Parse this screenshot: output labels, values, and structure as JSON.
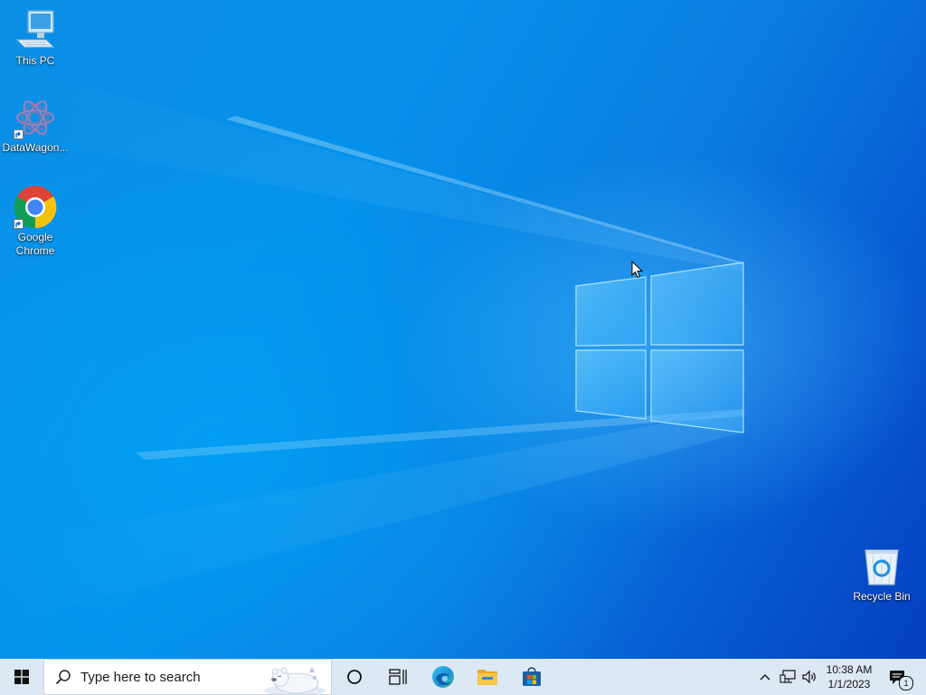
{
  "desktop": {
    "icons": [
      {
        "label": "This PC",
        "icon": "computer-icon"
      },
      {
        "label": "DataWagon...",
        "icon": "datawagon-icon"
      },
      {
        "label": "Google\nChrome",
        "icon": "chrome-icon"
      },
      {
        "label": "Recycle Bin",
        "icon": "recycle-bin-icon"
      }
    ]
  },
  "taskbar": {
    "search_placeholder": "Type here to search",
    "pinned": [
      {
        "name": "Cortana",
        "icon": "cortana-circle-icon"
      },
      {
        "name": "Task View",
        "icon": "task-view-icon"
      },
      {
        "name": "Microsoft Edge",
        "icon": "edge-icon"
      },
      {
        "name": "File Explorer",
        "icon": "folder-icon"
      },
      {
        "name": "Microsoft Store",
        "icon": "store-icon"
      }
    ],
    "tray": {
      "time": "10:38 AM",
      "date": "1/1/2023",
      "notification_count": "1"
    }
  },
  "colors": {
    "taskbar_bg": "#dce8f4",
    "wallpaper_accent": "#0a8fe6"
  }
}
